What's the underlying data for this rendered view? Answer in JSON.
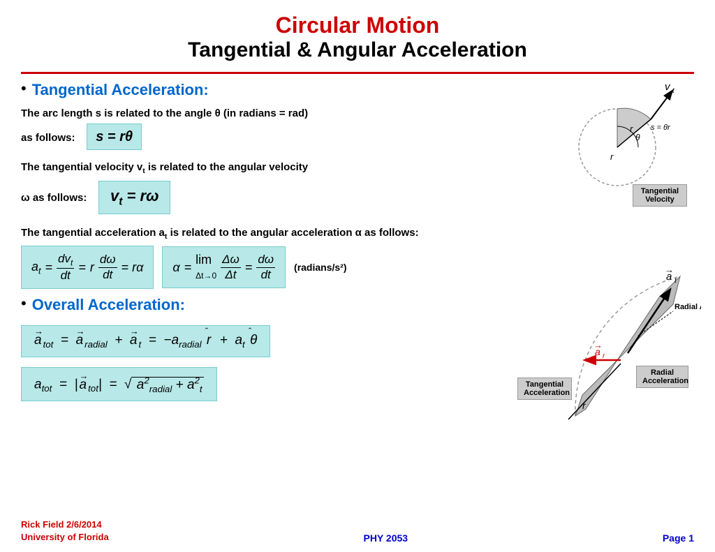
{
  "header": {
    "subtitle": "Circular Motion",
    "title": "Tangential & Angular Acceleration"
  },
  "section1": {
    "bullet": "•",
    "title": "Tangential Acceleration:",
    "text1": "The arc length s is related to the angle θ (in radians = rad)",
    "text1b": "as follows:",
    "formula1": "s = rθ",
    "text2_pre": "The tangential velocity v",
    "text2_sub": "t",
    "text2_post": " is related to the angular velocity",
    "text2b": "ω as follows:",
    "formula2": "vt = rω",
    "text3": "The tangential acceleration a",
    "text3_sub": "t",
    "text3_post": " is related to the angular acceleration α as follows:",
    "tangential_velocity_box": [
      "Tangential",
      "Velocity"
    ]
  },
  "section2": {
    "bullet": "•",
    "title": "Overall Acceleration:",
    "radians_label": "(radians/s²)",
    "tangential_accel_box": [
      "Tangential",
      "Acceleration"
    ],
    "radial_axis_label": "Radial Axis",
    "radial_accel_box": [
      "Radial",
      "Acceleration"
    ]
  },
  "footer": {
    "author": "Rick Field 2/6/2014",
    "institution": "University of Florida",
    "course": "PHY 2053",
    "page": "Page 1"
  }
}
